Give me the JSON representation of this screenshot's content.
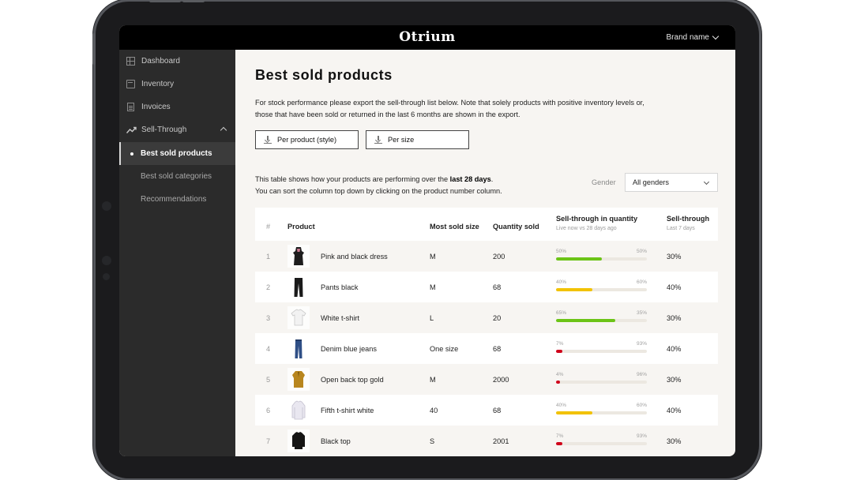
{
  "header": {
    "logo": "Otrium",
    "brand": "Brand name"
  },
  "sidebar": {
    "items": [
      {
        "label": "Dashboard",
        "icon": "dashboard-icon"
      },
      {
        "label": "Inventory",
        "icon": "inventory-icon"
      },
      {
        "label": "Invoices",
        "icon": "invoices-icon"
      },
      {
        "label": "Sell-Through",
        "icon": "trend-icon",
        "expanded": true
      }
    ],
    "subitems": [
      {
        "label": "Best sold products",
        "active": true
      },
      {
        "label": "Best sold categories"
      },
      {
        "label": "Recommendations"
      }
    ]
  },
  "main": {
    "title": "Best sold products",
    "intro_line1": "For stock performance please export the sell-through list below. Note that solely products with positive inventory levels or,",
    "intro_line2": "those that have been sold or returned in the last 6 months are shown in the export.",
    "export_style": "Per product (style)",
    "export_size": "Per size",
    "note_prefix": "This table shows how your products are performing over the ",
    "note_bold": "last 28 days",
    "note_suffix": ".",
    "note_line2": "You can sort the column top down by clicking on the product number column.",
    "gender_label": "Gender",
    "gender_value": "All genders"
  },
  "table": {
    "headers": {
      "num": "#",
      "product": "Product",
      "size": "Most sold size",
      "qty": "Quantity sold",
      "stq": "Sell-through in quantity",
      "stq_sub": "Live now vs 28 days ago",
      "st": "Sell-through",
      "st_sub": "Last 7 days"
    },
    "rows": [
      {
        "idx": "1",
        "name": "Pink and black dress",
        "size": "M",
        "qty": "200",
        "now": "50%",
        "ago": "50%",
        "fill": 0.5,
        "color": "#6cc417",
        "st": "30%"
      },
      {
        "idx": "2",
        "name": "Pants black",
        "size": "M",
        "qty": "68",
        "now": "40%",
        "ago": "60%",
        "fill": 0.4,
        "color": "#f2c200",
        "st": "40%"
      },
      {
        "idx": "3",
        "name": "White t-shirt",
        "size": "L",
        "qty": "20",
        "now": "65%",
        "ago": "35%",
        "fill": 0.65,
        "color": "#6cc417",
        "st": "30%"
      },
      {
        "idx": "4",
        "name": "Denim blue jeans",
        "size": "One size",
        "qty": "68",
        "now": "7%",
        "ago": "93%",
        "fill": 0.07,
        "color": "#d0021b",
        "st": "40%"
      },
      {
        "idx": "5",
        "name": "Open back top gold",
        "size": "M",
        "qty": "2000",
        "now": "4%",
        "ago": "96%",
        "fill": 0.04,
        "color": "#d0021b",
        "st": "30%"
      },
      {
        "idx": "6",
        "name": "Fifth t-shirt white",
        "size": "40",
        "qty": "68",
        "now": "40%",
        "ago": "60%",
        "fill": 0.4,
        "color": "#f2c200",
        "st": "40%"
      },
      {
        "idx": "7",
        "name": "Black top",
        "size": "S",
        "qty": "2001",
        "now": "7%",
        "ago": "93%",
        "fill": 0.07,
        "color": "#d0021b",
        "st": "30%"
      }
    ]
  }
}
